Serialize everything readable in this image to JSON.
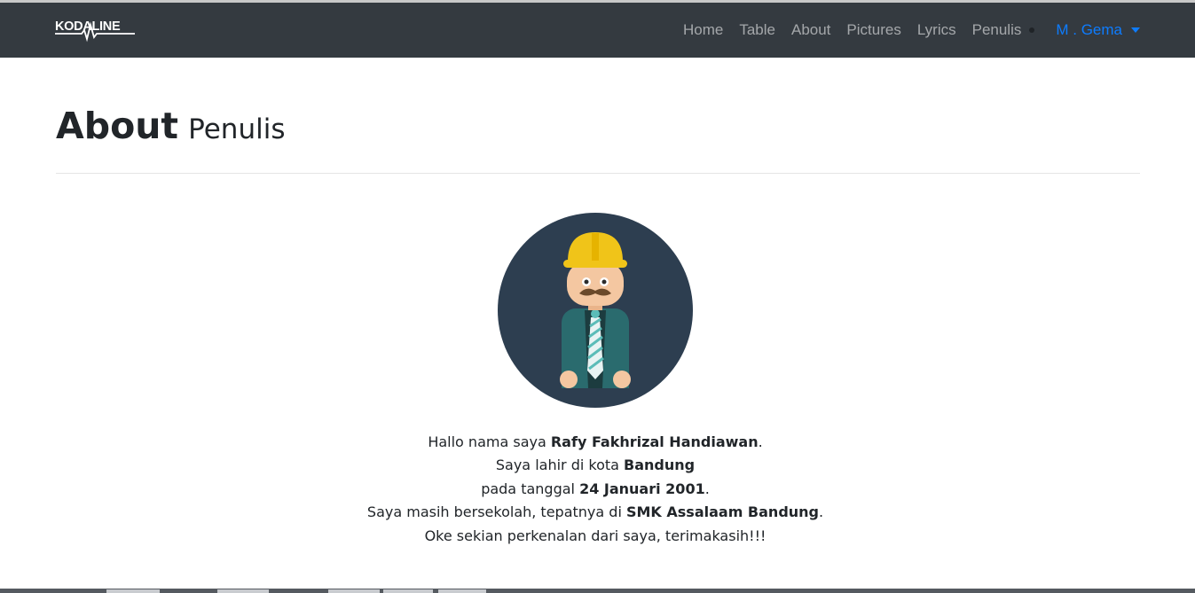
{
  "brand": {
    "logo_text": "KODALINE"
  },
  "nav": {
    "items": [
      "Home",
      "Table",
      "About",
      "Pictures",
      "Lyrics",
      "Penulis"
    ],
    "user_label": "M . Gema"
  },
  "header": {
    "title": "About",
    "subtitle": "Penulis"
  },
  "bio": {
    "line1_prefix": "Hallo nama saya ",
    "line1_bold": "Rafy Fakhrizal Handiawan",
    "line1_suffix": ".",
    "line2_prefix": "Saya lahir di kota ",
    "line2_bold": "Bandung",
    "line3_prefix": "pada tanggal ",
    "line3_bold": "24 Januari 2001",
    "line3_suffix": ".",
    "line4_prefix": "Saya masih bersekolah, tepatnya di ",
    "line4_bold": "SMK Assalaam Bandung",
    "line4_suffix": ".",
    "line5": "Oke sekian perkenalan dari saya, terimakasih!!!"
  },
  "colors": {
    "navbar_bg": "#343a40",
    "nav_link": "#9a9da0",
    "nav_user": "#0d7cff",
    "avatar_bg": "#2d3e50",
    "helmet": "#f0c419",
    "jacket": "#2a6b6e"
  },
  "icons": {
    "avatar": "construction-worker-avatar-icon",
    "dropdown": "caret-down-icon"
  }
}
